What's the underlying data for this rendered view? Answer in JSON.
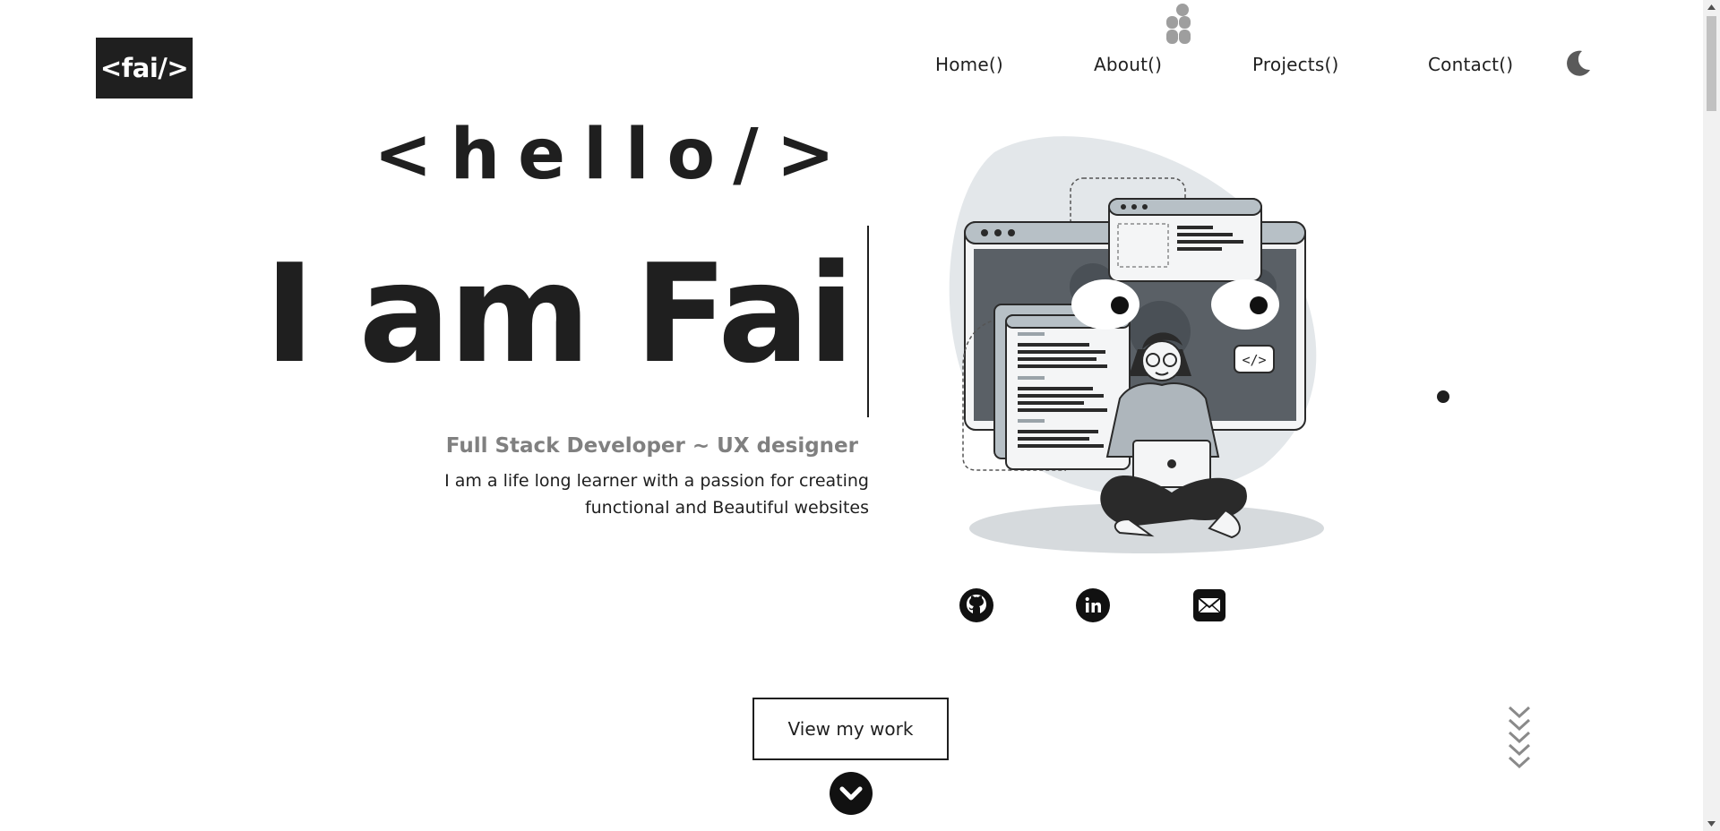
{
  "logo": {
    "text": "<fai/>"
  },
  "nav": {
    "items": [
      {
        "label": "Home()"
      },
      {
        "label": "About()"
      },
      {
        "label": "Projects()"
      },
      {
        "label": "Contact()"
      }
    ],
    "theme_toggle_icon": "moon-icon"
  },
  "hero": {
    "greeting": "<hello/>",
    "name": "I am Fai",
    "role": "Full Stack Developer ~ UX designer",
    "description": "I am a life long learner with a passion for creating functional and Beautiful websites",
    "illustration": "developer-illustration"
  },
  "social": [
    {
      "icon": "github-icon"
    },
    {
      "icon": "linkedin-icon"
    },
    {
      "icon": "email-icon"
    }
  ],
  "cta": {
    "label": "View my work",
    "icon": "chevron-down-circle-icon"
  },
  "scroll_hint_icon": "chevrons-down-icon",
  "colors": {
    "primary": "#1f1f1f",
    "muted": "#808080",
    "background": "#ffffff",
    "illustration_gray": "#e3e7ea"
  }
}
